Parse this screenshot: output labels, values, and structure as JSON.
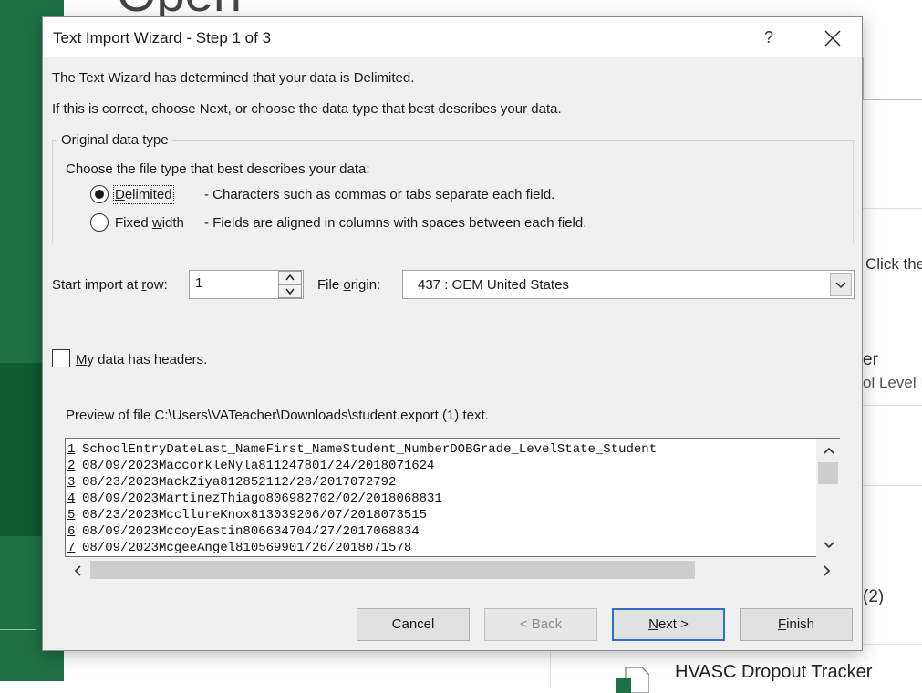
{
  "background": {
    "heading": "Open",
    "side_texts": [
      "Click the",
      "er",
      "ol Level I",
      "(2)"
    ],
    "recent_file": "HVASC Dropout Tracker"
  },
  "dialog": {
    "title": "Text Import Wizard - Step 1 of 3",
    "help_glyph": "?",
    "intro1": "The Text Wizard has determined that your data is Delimited.",
    "intro2": "If this is correct, choose Next, or choose the data type that best describes your data.",
    "group_title": "Original data type",
    "choose_label": "Choose the file type that best describes your data:",
    "radio_delimited": {
      "pre": "",
      "key": "D",
      "post": "elimited",
      "desc": "- Characters such as commas or tabs separate each field.",
      "selected": true
    },
    "radio_fixed": {
      "pre": "Fixed ",
      "key": "w",
      "post": "idth",
      "desc": "- Fields are aligned in columns with spaces between each field.",
      "selected": false
    },
    "start_row": {
      "pre": "Start import at ",
      "key": "r",
      "post": "ow:",
      "value": "1"
    },
    "file_origin": {
      "pre": "File ",
      "key": "o",
      "post": "rigin:",
      "value": "437 : OEM United States"
    },
    "headers_checkbox": {
      "pre": "",
      "key": "M",
      "post": "y data has headers.",
      "checked": false
    },
    "preview_label": "Preview of file C:\\Users\\VATeacher\\Downloads\\student.export (1).text.",
    "preview_lines": [
      {
        "num": "1",
        "text": "SchoolEntryDateLast_NameFirst_NameStudent_NumberDOBGrade_LevelState_Student"
      },
      {
        "num": "2",
        "text": "08/09/2023MaccorkleNyla811247801/24/2018071624"
      },
      {
        "num": "3",
        "text": "08/23/2023MackZiya812852112/28/2017072792"
      },
      {
        "num": "4",
        "text": "08/09/2023MartinezThiago806982702/02/2018068831"
      },
      {
        "num": "5",
        "text": "08/23/2023MccllureKnox813039206/07/2018073515"
      },
      {
        "num": "6",
        "text": "08/09/2023MccoyEastin806634704/27/2017068834"
      },
      {
        "num": "7",
        "text": "08/09/2023McgeeAngel810569901/26/2018071578"
      }
    ],
    "buttons": {
      "cancel": "Cancel",
      "back": "< Back",
      "next_key": "N",
      "next_post": "ext >",
      "finish_key": "F",
      "finish_post": "inish"
    }
  }
}
